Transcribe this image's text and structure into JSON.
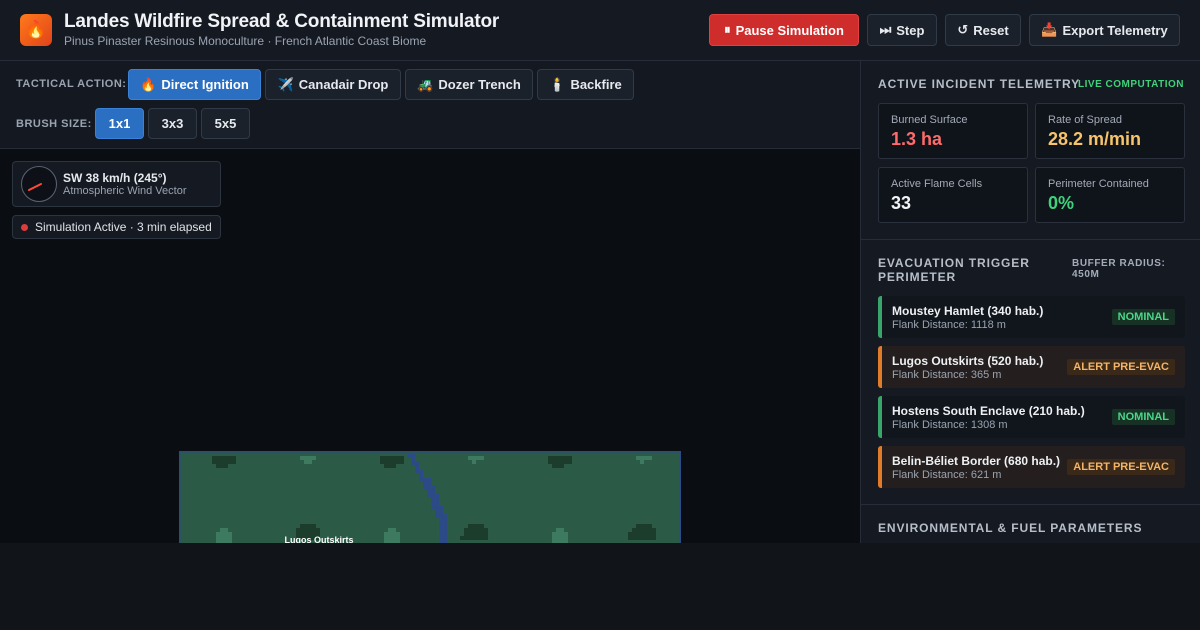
{
  "header": {
    "title": "Landes Wildfire Spread & Containment Simulator",
    "subtitle": "Pinus Pinaster Resinous Monoculture · French Atlantic Coast Biome",
    "logo_icon": "🔥",
    "buttons": {
      "pause": {
        "icon": "⏸",
        "label": "Pause Simulation"
      },
      "step": {
        "icon": "⏭",
        "label": "Step"
      },
      "reset": {
        "icon": "↺",
        "label": "Reset"
      },
      "export": {
        "icon": "📥",
        "label": "Export Telemetry"
      }
    }
  },
  "toolbar": {
    "tactical_label": "TACTICAL ACTION:",
    "tactical_actions": [
      {
        "icon": "🔥",
        "label": "Direct Ignition",
        "active": true
      },
      {
        "icon": "✈️",
        "label": "Canadair Drop",
        "active": false
      },
      {
        "icon": "🚜",
        "label": "Dozer Trench",
        "active": false
      },
      {
        "icon": "🕯️",
        "label": "Backfire",
        "active": false
      }
    ],
    "brush_label": "BRUSH SIZE:",
    "brush_sizes": [
      {
        "label": "1x1",
        "active": true
      },
      {
        "label": "3x3",
        "active": false
      },
      {
        "label": "5x5",
        "active": false
      }
    ]
  },
  "map": {
    "wind": {
      "title": "SW 38 km/h (245°)",
      "subtitle": "Atmospheric Wind Vector",
      "direction_deg": 245
    },
    "status": "Simulation Active · 3 min elapsed",
    "place_label": "Lugos Outskirts",
    "colors": {
      "forest": "#2b5a47",
      "tree": "#1d3d2c",
      "light_tree": "#3d7a5f",
      "water": "#2c4a86"
    }
  },
  "telemetry": {
    "title": "Active Incident Telemetry",
    "live_label": "LIVE COMPUTATION",
    "metrics": [
      {
        "label": "Burned Surface",
        "value": "1.3 ha",
        "color": "#ff6b6b"
      },
      {
        "label": "Rate of Spread",
        "value": "28.2 m/min",
        "color": "#f7c46c"
      },
      {
        "label": "Active Flame Cells",
        "value": "33",
        "color": "#f1f3f6"
      },
      {
        "label": "Perimeter Contained",
        "value": "0%",
        "color": "#3ed27a"
      }
    ]
  },
  "evacuation": {
    "title": "Evacuation Trigger Perimeter",
    "buffer_label": "BUFFER RADIUS: 450M",
    "zones": [
      {
        "name": "Moustey Hamlet (340 hab.)",
        "distance": "Flank Distance: 1118 m",
        "status": "NOMINAL",
        "level": "nominal"
      },
      {
        "name": "Lugos Outskirts (520 hab.)",
        "distance": "Flank Distance: 365 m",
        "status": "ALERT PRE-EVAC",
        "level": "alert"
      },
      {
        "name": "Hostens South Enclave (210 hab.)",
        "distance": "Flank Distance: 1308 m",
        "status": "NOMINAL",
        "level": "nominal"
      },
      {
        "name": "Belin-Béliet Border (680 hab.)",
        "distance": "Flank Distance: 621 m",
        "status": "ALERT PRE-EVAC",
        "level": "alert"
      }
    ]
  },
  "environment": {
    "title": "Environmental & Fuel Parameters"
  }
}
